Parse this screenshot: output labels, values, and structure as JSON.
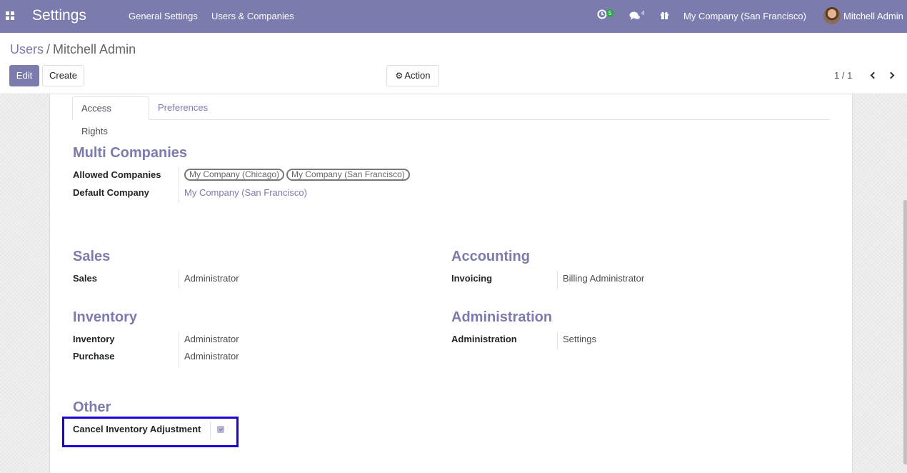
{
  "navbar": {
    "app_title": "Settings",
    "menu": [
      "General Settings",
      "Users & Companies"
    ],
    "activity_count": "5",
    "messages_count": "4",
    "company": "My Company (San Francisco)",
    "user": "Mitchell Admin",
    "icons": [
      "apps-icon",
      "activity-clock-icon",
      "chat-icon",
      "gift-icon",
      "avatar"
    ]
  },
  "control_panel": {
    "breadcrumb_parent": "Users",
    "breadcrumb_sep": "/",
    "breadcrumb_current": "Mitchell Admin",
    "edit_label": "Edit",
    "create_label": "Create",
    "action_label": "Action",
    "pager": "1 / 1"
  },
  "tabs": [
    "Access Rights",
    "Preferences"
  ],
  "multi_companies": {
    "title": "Multi Companies",
    "allowed_label": "Allowed Companies",
    "allowed_tags": [
      "My Company (Chicago)",
      "My Company (San Francisco)"
    ],
    "default_label": "Default Company",
    "default_value": "My Company (San Francisco)"
  },
  "sales": {
    "title": "Sales",
    "fields": [
      {
        "label": "Sales",
        "value": "Administrator"
      }
    ]
  },
  "accounting": {
    "title": "Accounting",
    "fields": [
      {
        "label": "Invoicing",
        "value": "Billing Administrator"
      }
    ]
  },
  "inventory": {
    "title": "Inventory",
    "fields": [
      {
        "label": "Inventory",
        "value": "Administrator"
      },
      {
        "label": "Purchase",
        "value": "Administrator"
      }
    ]
  },
  "administration": {
    "title": "Administration",
    "fields": [
      {
        "label": "Administration",
        "value": "Settings"
      }
    ]
  },
  "other": {
    "title": "Other",
    "fields": [
      {
        "label": "Cancel Inventory Adjustment",
        "checked": true
      }
    ]
  },
  "colors": {
    "brand": "#7c7bad",
    "highlight": "#1a00d6"
  }
}
